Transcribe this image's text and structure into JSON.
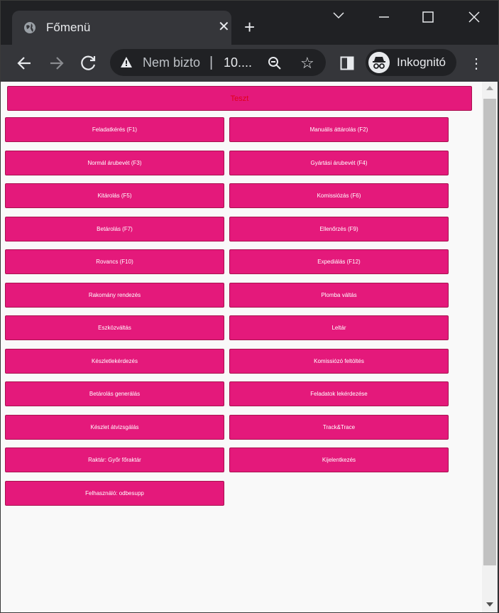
{
  "tab": {
    "title": "Főmenü",
    "close": "✕"
  },
  "newtab": "+",
  "window": {
    "minimize": "⌄",
    "maximize": "☐",
    "close": "✕"
  },
  "omnibox": {
    "security": "Nem bizto",
    "url": "10...."
  },
  "profile": {
    "label": "Inkognitó"
  },
  "accent_color": "#e4197b",
  "test_button": "Teszt",
  "left_buttons": [
    "Feladatkérés (F1)",
    "Normál árubevét (F3)",
    "Kitárolás (F5)",
    "Betárolás (F7)",
    "Rovancs (F10)",
    "Rakomány rendezés",
    "Eszközváltás",
    "Készletlekérdezés",
    "Betárolás generálás",
    "Készlet átvizsgálás",
    "Raktár: Győr főraktár",
    "Felhasználó: odbesupp"
  ],
  "right_buttons": [
    "Manuális áttárolás (F2)",
    "Gyártási árubevét (F4)",
    "Komissiózás (F6)",
    "Ellenőrzés (F9)",
    "Expediálás (F12)",
    "Plomba váltás",
    "Leltár",
    "Komissiózó feltöltés",
    "Feladatok lekérdezése",
    "Track&Trace",
    "Kijelentkezés"
  ]
}
